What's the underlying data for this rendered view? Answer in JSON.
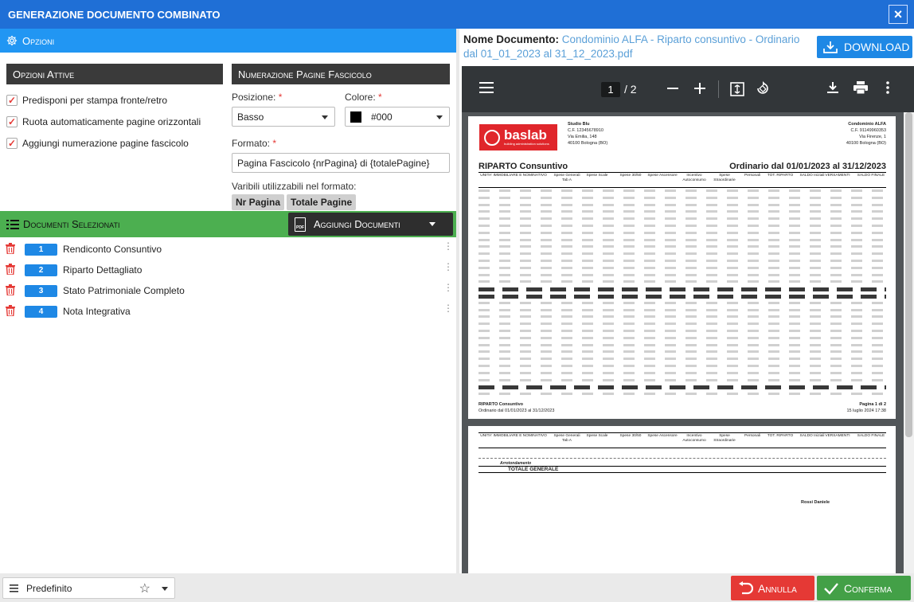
{
  "window": {
    "title": "GENERAZIONE DOCUMENTO COMBINATO",
    "close_icon": "close-icon"
  },
  "options": {
    "header": "Opzioni",
    "active": {
      "title": "Opzioni Attive",
      "items": [
        {
          "label": "Predisponi per stampa fronte/retro",
          "checked": true
        },
        {
          "label": "Ruota automaticamente pagine orizzontali",
          "checked": true
        },
        {
          "label": "Aggiungi numerazione pagine fascicolo",
          "checked": true
        }
      ]
    },
    "numbering": {
      "title": "Numerazione Pagine Fascicolo",
      "position_label": "Posizione:",
      "position_value": "Basso",
      "color_label": "Colore:",
      "color_value": "#000",
      "format_label": "Formato:",
      "format_value": "Pagina Fascicolo {nrPagina} di {totalePagine}",
      "vars_label": "Varibili utilizzabili nel formato:",
      "vars": [
        "Nr Pagina",
        "Totale Pagine"
      ]
    }
  },
  "documents": {
    "header": "Documenti Selezionati",
    "add_button": "Aggiungi Documenti",
    "items": [
      {
        "num": "1",
        "name": "Rendiconto Consuntivo"
      },
      {
        "num": "2",
        "name": "Riparto Dettagliato"
      },
      {
        "num": "3",
        "name": "Stato Patrimoniale Completo"
      },
      {
        "num": "4",
        "name": "Nota Integrativa"
      }
    ]
  },
  "preview": {
    "doc_label": "Nome Documento:",
    "doc_name": "Condominio ALFA - Riparto consuntivo - Ordinario dal 01_01_2023 al 31_12_2023.pdf",
    "download_label": "DOWNLOAD",
    "viewer": {
      "current_page": "1",
      "total_pages": "/ 2"
    },
    "pdf": {
      "logo": "baslab",
      "logo_sub": "building administration solutions",
      "studio": [
        "Studio Blu",
        "C.F. 12345678910",
        "Via Emilia, 148",
        "40100 Bologna (BO)"
      ],
      "condominio": [
        "Condominio ALFA",
        "C.F. 91149960353",
        "Via Firenze, 1",
        "40100 Bologna (BO)"
      ],
      "title": "RIPARTO Consuntivo",
      "period": "Ordinario dal 01/01/2023 al 31/12/2023",
      "columns": [
        "UNITA' IMMOBILIARE E NOMINATIVO",
        "Spese Generali Tab A",
        "Spese Scale",
        "Spese 30/50",
        "Spese Ascensore",
        "Incentivo Autoconsumo",
        "Spese Straordinarie",
        "Personali",
        "TOT. RIPARTO",
        "SALDO Iniziali",
        "VERSAMENTI",
        "SALDO FINALE"
      ],
      "footer_left": [
        "RIPARTO Consuntivo",
        "Ordinario dal 01/01/2023 al 31/12/2023"
      ],
      "footer_right": [
        "Pagina 1 di 2",
        "15 luglio 2024 17:38"
      ],
      "page2_total_label": "TOTALE GENERALE",
      "page2_arrot_label": "Arrotondamento",
      "page2_signature": "Rossi Daniele"
    }
  },
  "footer": {
    "preset_value": "Predefinito",
    "cancel_label": "Annulla",
    "confirm_label": "Conferma"
  }
}
